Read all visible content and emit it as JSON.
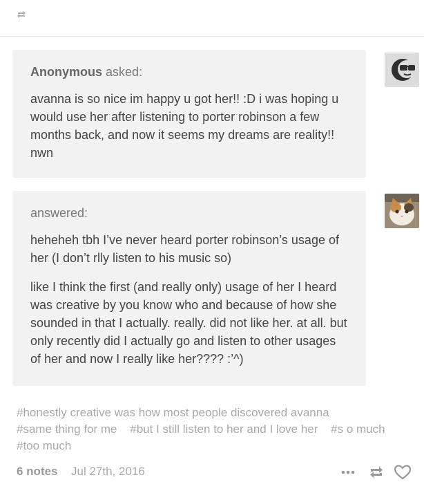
{
  "header": {
    "reblog_icon": "reblog-icon"
  },
  "ask": {
    "asker": "Anonymous",
    "verb": "asked:",
    "question": "avanna is so nice im happy u got her!! :D i was hoping u would use her after listening to porter robinson a few months back, and now it seems my dreams are reality!! nwn",
    "avatar": "anonymous-sunglasses-avatar"
  },
  "answer": {
    "label": "answered:",
    "paragraphs": [
      "heheheh tbh I’ve never heard porter robinson’s usage of her (I don’t rlly listen to his music so)",
      "like I think the first (and really only) usage of her I heard was creative by you know who and because of how she sounded in that I actually. really. did not like her. at all. but only recently did I actually go and listen to other usages of her and now I really like her???? :’^)"
    ],
    "avatar": "cat-avatar"
  },
  "tags": [
    "#honestly creative was how most people discovered avanna",
    "#same thing for me",
    "#but I still listen to her and I love her",
    "#s o much",
    "#too much"
  ],
  "footer": {
    "notes": "6 notes",
    "date": "Jul 27th, 2016"
  },
  "colors": {
    "bubble_bg": "#f2f2f2",
    "text": "#444444",
    "muted": "#a8a8a8",
    "icon": "#999999"
  }
}
